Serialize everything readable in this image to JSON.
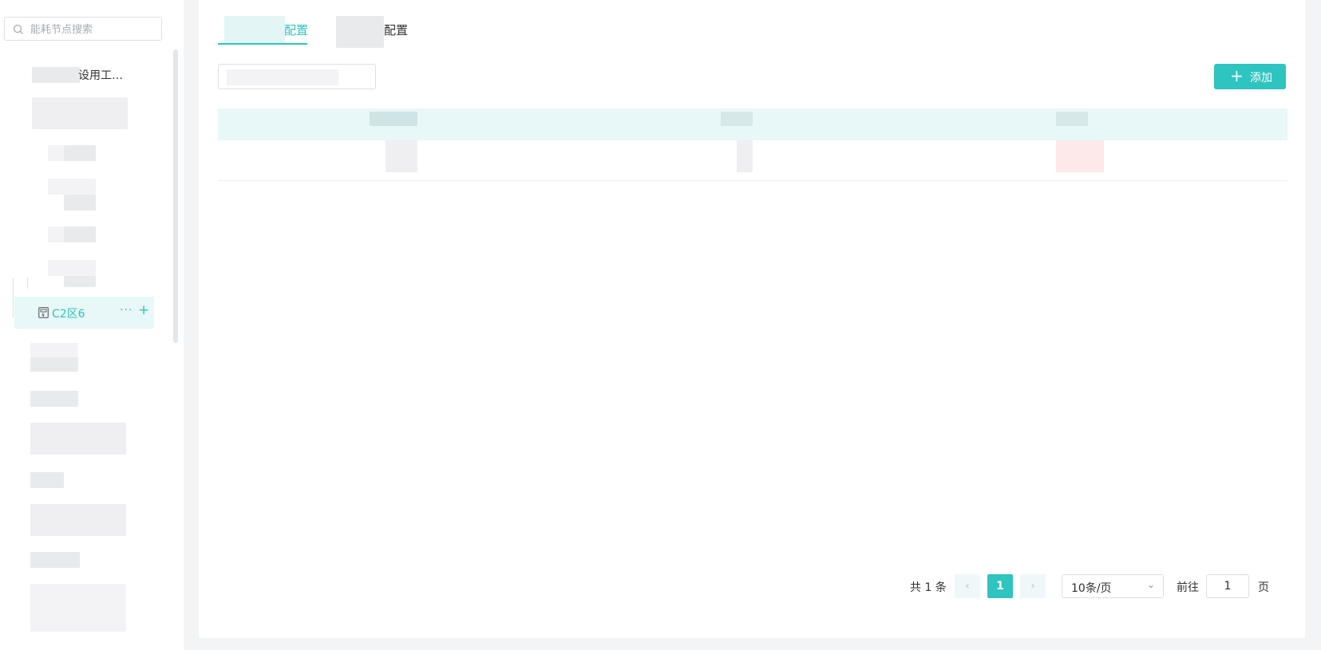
{
  "sidebar": {
    "search": {
      "placeholder": "能耗节点搜索",
      "value": ""
    },
    "tree": {
      "first_node_suffix": "设用工…",
      "selected_node": {
        "label": "C2区6",
        "more": "···",
        "add": "+"
      }
    }
  },
  "main": {
    "tabs": [
      {
        "label": "能耗节点配置",
        "visible_text": "配置",
        "active": true
      },
      {
        "label": "配置",
        "visible_text": "配置",
        "active": false
      }
    ],
    "add_button_label": "添加",
    "add_button_icon": "plus-icon",
    "pagination": {
      "total_text": "共 1 条",
      "current_page": "1",
      "page_size": "10条/页",
      "goto_prefix": "前往",
      "goto_value": "1",
      "goto_suffix": "页"
    }
  },
  "colors": {
    "accent": "#2ec4c0",
    "header_bg": "#e8f7f7",
    "selected_bg": "#e8f7f7"
  }
}
